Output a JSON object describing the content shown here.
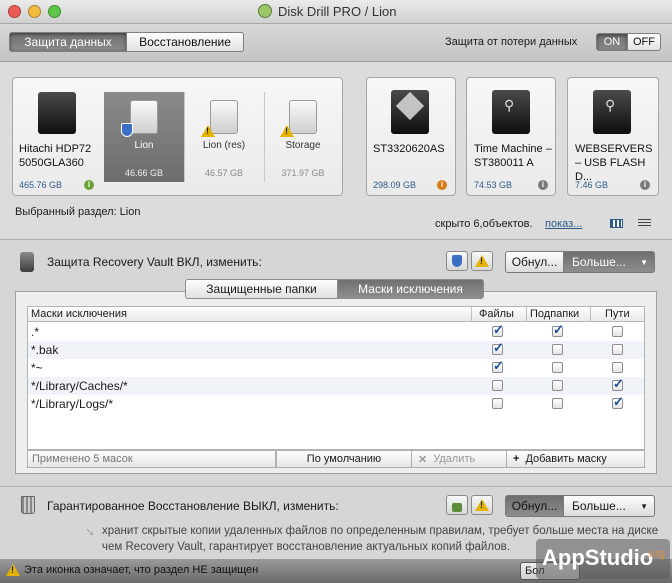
{
  "window": {
    "title": "Disk Drill PRO  / Lion"
  },
  "toolbar": {
    "tab_protection": "Защита данных",
    "tab_recovery": "Восстановление",
    "loss_protection_label": "Защита от потери данных",
    "toggle_on": "ON",
    "toggle_off": "OFF"
  },
  "drives": [
    {
      "name": "Hitachi HDP72 5050GLA360",
      "size": "465.76 GB",
      "status_icon": "info-green-icon"
    },
    {
      "name": "ST3320620AS",
      "size": "298.09 GB",
      "status_icon": "info-orange-icon"
    },
    {
      "name": "Time Machine – ST380011 A",
      "size": "74.53 GB",
      "status_icon": "info-gray-icon"
    },
    {
      "name": "WEBSERVERS – USB FLASH D...",
      "size": "7.46 GB",
      "status_icon": "info-gray-icon"
    }
  ],
  "partitions": [
    {
      "name": "Lion",
      "size": "46.66 GB",
      "icon": "shield-icon",
      "selected": true
    },
    {
      "name": "Lion (res)",
      "size": "46.57 GB",
      "icon": "warning-icon",
      "selected": false
    },
    {
      "name": "Storage",
      "size": "371.97 GB",
      "icon": "warning-icon",
      "selected": false
    }
  ],
  "selection": {
    "selected_label": "Выбранный раздел: Lion",
    "hidden_text": "скрыто 6,объектов.",
    "show_link": "показ..."
  },
  "vault": {
    "title_prefix": "Защита Recovery Vault ВКЛ",
    "title_suffix": ", изменить:",
    "reset_button": "Обнул...",
    "more_button": "Больше...",
    "tab_protected": "Защищенные папки",
    "tab_masks": "Маски исключения",
    "columns": [
      "Маски исключения",
      "Файлы",
      "Подпапки",
      "Пути"
    ],
    "rows": [
      {
        "mask": ".*",
        "files": true,
        "subfolders": true,
        "paths": false
      },
      {
        "mask": "*.bak",
        "files": true,
        "subfolders": false,
        "paths": false
      },
      {
        "mask": "*~",
        "files": true,
        "subfolders": false,
        "paths": false
      },
      {
        "mask": "*/Library/Caches/*",
        "files": false,
        "subfolders": false,
        "paths": true
      },
      {
        "mask": "*/Library/Logs/*",
        "files": false,
        "subfolders": false,
        "paths": true
      }
    ],
    "applied_text": "Применено 5 масок",
    "default_button": "По умолчанию",
    "delete_button": "Удалить",
    "add_button": "Добавить маску"
  },
  "guaranteed": {
    "title_prefix": "Гарантированное Восстановление ВЫКЛ",
    "title_suffix": ", изменить:",
    "reset_button": "Обнул...",
    "more_button": "Больше...",
    "description": "хранит скрытые копии удаленных файлов по определенным правилам, требует больше места на диске чем Recovery Vault, гарантирует восстановление актуальных копий файлов."
  },
  "status": {
    "legend": "Эта иконка означает, что раздел НЕ защищен",
    "button_partial": "Бол",
    "watermark": "AppStudio",
    "watermark_suffix": ".org"
  },
  "colors": {
    "accent_blue": "#2c5b8a",
    "warning": "#e6b400",
    "shield": "#3a6fc4"
  }
}
